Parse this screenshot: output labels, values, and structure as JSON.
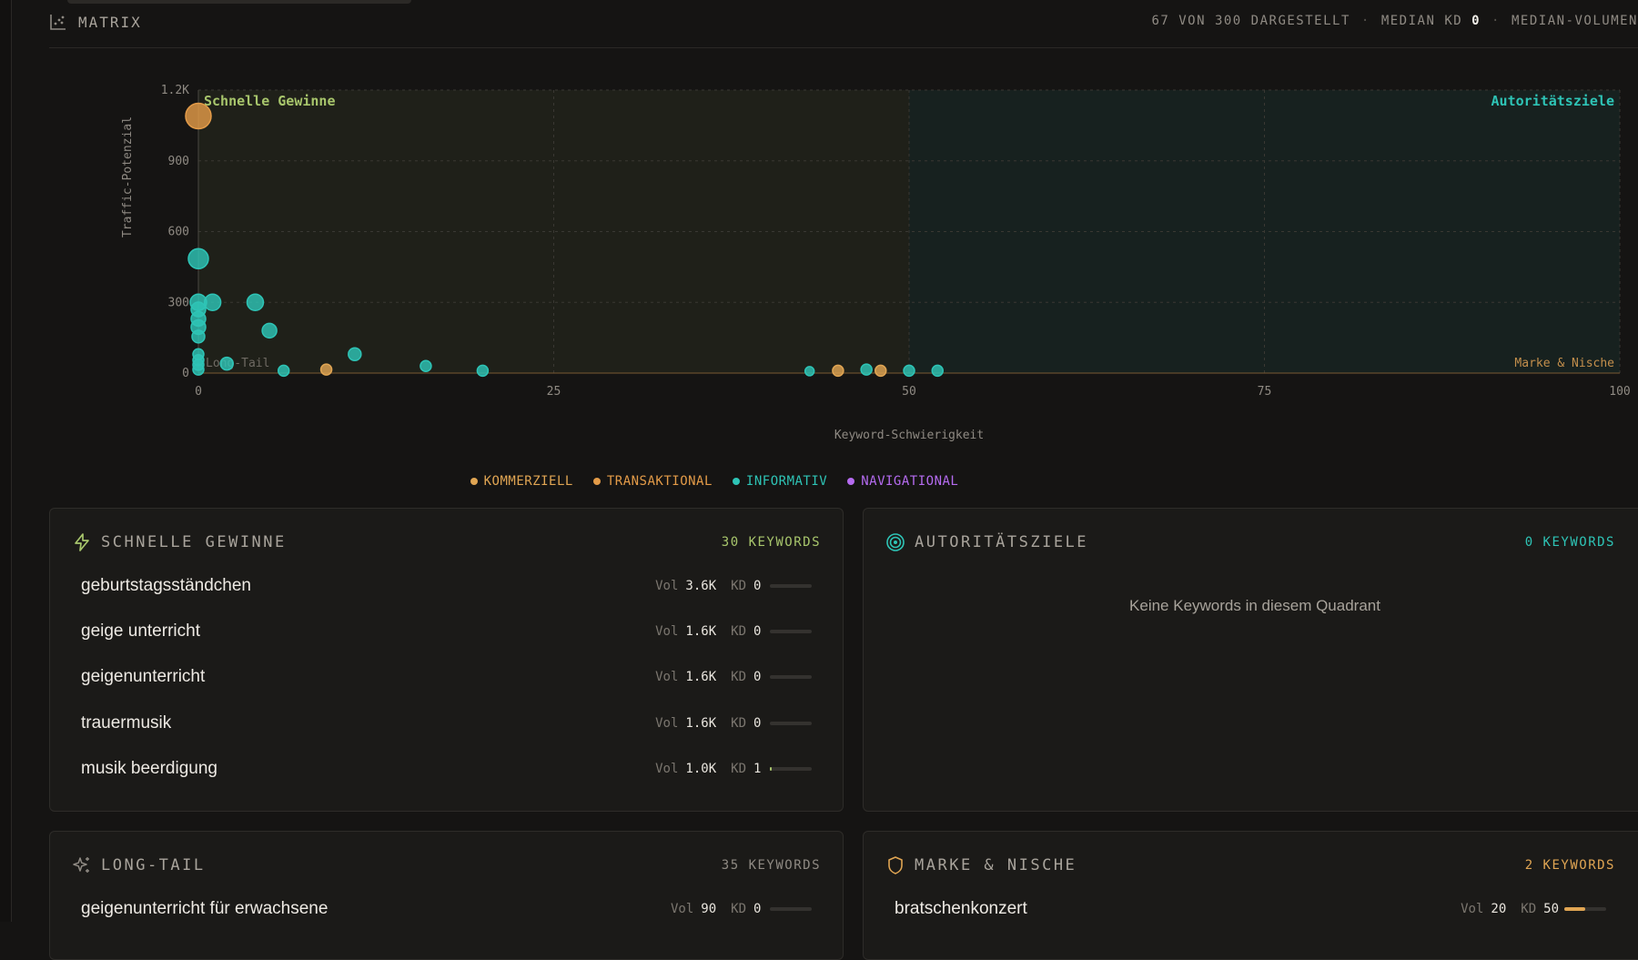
{
  "colors": {
    "kommerziell": "#e0a553",
    "transaktional": "#e39b48",
    "informativ": "#2ec4b6",
    "navigational": "#b56bf0",
    "quick_wins": "#a8c66c",
    "authority": "#2ec4b6",
    "niche": "#e0a553"
  },
  "header": {
    "title": "MATRIX",
    "icon": "scatter-chart-icon",
    "stat_shown": "67 VON 300 DARGESTELLT",
    "stat_median_kd_label": "MEDIAN KD",
    "stat_median_kd_value": "0",
    "stat_median_volume": "MEDIAN-VOLUMEN"
  },
  "chart_data": {
    "type": "scatter",
    "xlabel": "Keyword-Schwierigkeit",
    "ylabel": "Traffic-Potenzial",
    "xlim": [
      0,
      100
    ],
    "ylim": [
      0,
      1200
    ],
    "x_ticks": [
      "0",
      "25",
      "50",
      "75",
      "100"
    ],
    "y_ticks": [
      "0",
      "300",
      "600",
      "900",
      "1.2K"
    ],
    "y_tick_values": [
      0,
      300,
      600,
      900,
      1200
    ],
    "x_tick_values": [
      0,
      25,
      50,
      75,
      100
    ],
    "quadrant_labels": {
      "top_left": "Schnelle Gewinne",
      "top_right": "Autoritätsziele",
      "bottom_left": "Long-Tail",
      "bottom_right": "Marke & Nische"
    },
    "grid": true,
    "points": [
      {
        "x": 0,
        "y": 1090,
        "intent": "transaktional",
        "r": 14
      },
      {
        "x": 0,
        "y": 485,
        "intent": "informativ",
        "r": 11
      },
      {
        "x": 0,
        "y": 300,
        "intent": "informativ",
        "r": 9
      },
      {
        "x": 0,
        "y": 270,
        "intent": "informativ",
        "r": 8
      },
      {
        "x": 0,
        "y": 230,
        "intent": "informativ",
        "r": 8
      },
      {
        "x": 0,
        "y": 195,
        "intent": "informativ",
        "r": 8
      },
      {
        "x": 0,
        "y": 155,
        "intent": "informativ",
        "r": 7
      },
      {
        "x": 0,
        "y": 80,
        "intent": "informativ",
        "r": 6
      },
      {
        "x": 0,
        "y": 55,
        "intent": "informativ",
        "r": 6
      },
      {
        "x": 0,
        "y": 35,
        "intent": "informativ",
        "r": 6
      },
      {
        "x": 0,
        "y": 15,
        "intent": "informativ",
        "r": 6
      },
      {
        "x": 1,
        "y": 300,
        "intent": "informativ",
        "r": 9
      },
      {
        "x": 2,
        "y": 40,
        "intent": "informativ",
        "r": 7
      },
      {
        "x": 4,
        "y": 300,
        "intent": "informativ",
        "r": 9
      },
      {
        "x": 5,
        "y": 180,
        "intent": "informativ",
        "r": 8
      },
      {
        "x": 6,
        "y": 10,
        "intent": "informativ",
        "r": 6
      },
      {
        "x": 9,
        "y": 15,
        "intent": "kommerziell",
        "r": 6
      },
      {
        "x": 11,
        "y": 80,
        "intent": "informativ",
        "r": 7
      },
      {
        "x": 16,
        "y": 30,
        "intent": "informativ",
        "r": 6
      },
      {
        "x": 20,
        "y": 10,
        "intent": "informativ",
        "r": 6
      },
      {
        "x": 43,
        "y": 8,
        "intent": "informativ",
        "r": 5
      },
      {
        "x": 45,
        "y": 10,
        "intent": "kommerziell",
        "r": 6
      },
      {
        "x": 47,
        "y": 15,
        "intent": "informativ",
        "r": 6
      },
      {
        "x": 48,
        "y": 10,
        "intent": "kommerziell",
        "r": 6
      },
      {
        "x": 50,
        "y": 10,
        "intent": "informativ",
        "r": 6
      },
      {
        "x": 52,
        "y": 10,
        "intent": "informativ",
        "r": 6
      }
    ]
  },
  "legend": [
    {
      "label": "KOMMERZIELL",
      "key": "kommerziell"
    },
    {
      "label": "TRANSAKTIONAL",
      "key": "transaktional"
    },
    {
      "label": "INFORMATIV",
      "key": "informativ"
    },
    {
      "label": "NAVIGATIONAL",
      "key": "navigational"
    }
  ],
  "quick_wins": {
    "title": "SCHNELLE GEWINNE",
    "icon": "lightning-icon",
    "count": "30 KEYWORDS",
    "rows": [
      {
        "keyword": "geburtstagsständchen",
        "vol_label": "Vol",
        "vol": "3.6K",
        "kd_label": "KD",
        "kd": "0",
        "kd_value": 0
      },
      {
        "keyword": "geige unterricht",
        "vol_label": "Vol",
        "vol": "1.6K",
        "kd_label": "KD",
        "kd": "0",
        "kd_value": 0
      },
      {
        "keyword": "geigenunterricht",
        "vol_label": "Vol",
        "vol": "1.6K",
        "kd_label": "KD",
        "kd": "0",
        "kd_value": 0
      },
      {
        "keyword": "trauermusik",
        "vol_label": "Vol",
        "vol": "1.6K",
        "kd_label": "KD",
        "kd": "0",
        "kd_value": 0
      },
      {
        "keyword": "musik beerdigung",
        "vol_label": "Vol",
        "vol": "1.0K",
        "kd_label": "KD",
        "kd": "1",
        "kd_value": 1
      }
    ]
  },
  "authority": {
    "title": "AUTORITÄTSZIELE",
    "icon": "target-icon",
    "count": "0 KEYWORDS",
    "empty_text": "Keine Keywords in diesem Quadrant"
  },
  "long_tail": {
    "title": "LONG-TAIL",
    "icon": "sparkles-icon",
    "count": "35 KEYWORDS",
    "rows": [
      {
        "keyword": "geigenunterricht für erwachsene",
        "vol_label": "Vol",
        "vol": "90",
        "kd_label": "KD",
        "kd": "0",
        "kd_value": 0
      }
    ]
  },
  "niche": {
    "title": "MARKE & NISCHE",
    "icon": "shield-icon",
    "count": "2 KEYWORDS",
    "rows": [
      {
        "keyword": "bratschenkonzert",
        "vol_label": "Vol",
        "vol": "20",
        "kd_label": "KD",
        "kd": "50",
        "kd_value": 50
      }
    ]
  }
}
